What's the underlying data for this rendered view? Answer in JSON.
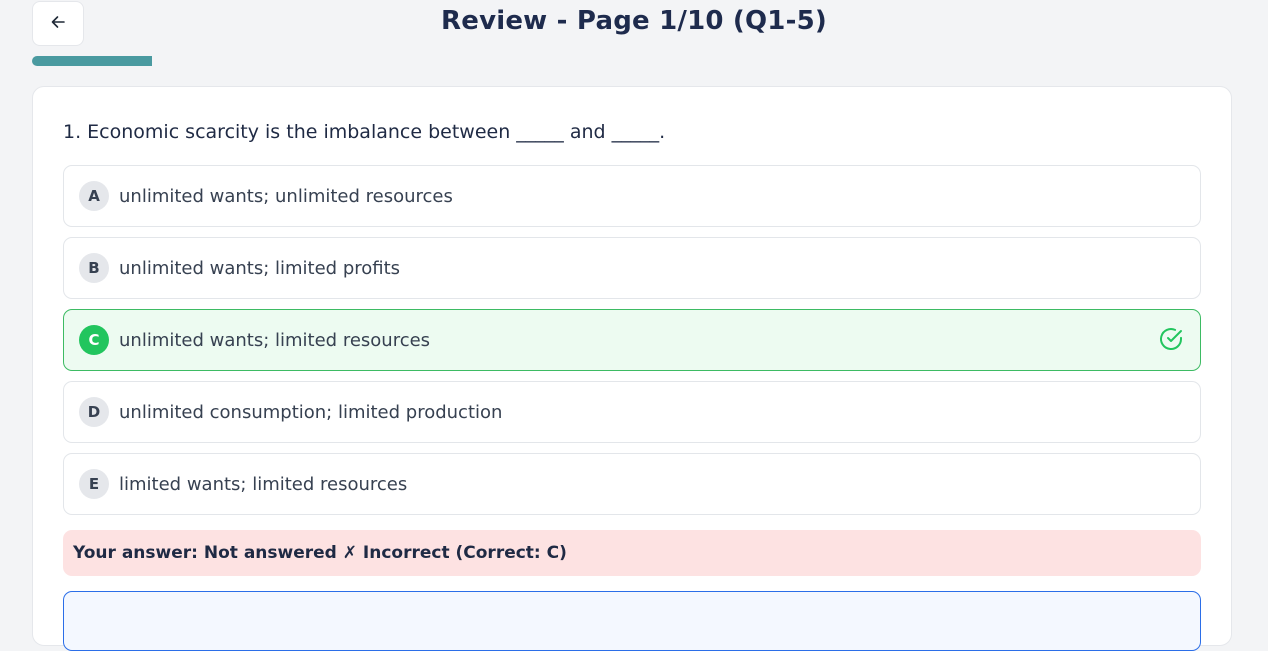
{
  "header": {
    "back_icon": "arrow-left-icon",
    "title": "Review - Page 1/10 (Q1-5)",
    "progress_fraction": 0.1,
    "progress_color": "#4a9aa0"
  },
  "question": {
    "text": "1. Economic scarcity is the imbalance between _____ and _____.",
    "options": [
      {
        "letter": "A",
        "text": "unlimited wants; unlimited resources",
        "correct": false
      },
      {
        "letter": "B",
        "text": "unlimited wants; limited profits",
        "correct": false
      },
      {
        "letter": "C",
        "text": "unlimited wants; limited resources",
        "correct": true
      },
      {
        "letter": "D",
        "text": "unlimited consumption; limited production",
        "correct": false
      },
      {
        "letter": "E",
        "text": "limited wants; limited resources",
        "correct": false
      }
    ],
    "correct_icon": "check-circle-icon",
    "answer_feedback": "Your answer: Not answered ✗ Incorrect (Correct: C)"
  },
  "colors": {
    "correct_accent": "#22c55e",
    "incorrect_bg": "#fde2e2",
    "info_border": "#2b6ee8"
  }
}
